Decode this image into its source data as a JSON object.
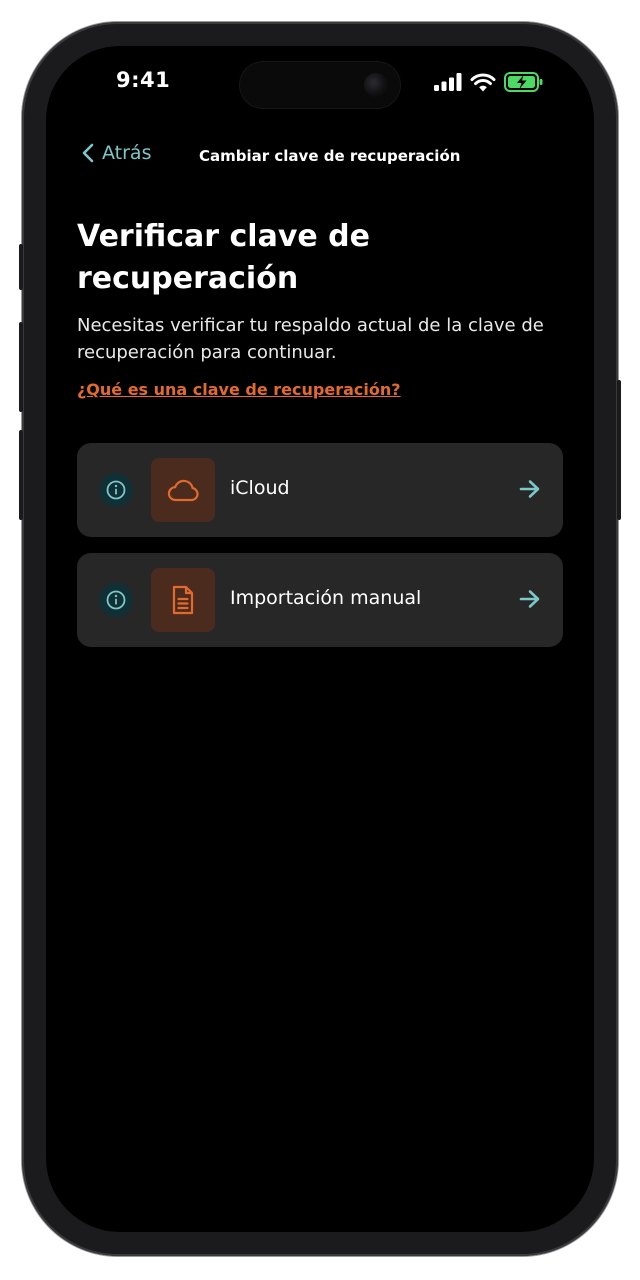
{
  "status_bar": {
    "time": "9:41"
  },
  "nav": {
    "back_label": "Atrás",
    "title": "Cambiar clave de recuperación"
  },
  "main": {
    "heading": "Verificar clave de recuperación",
    "description": "Necesitas verificar tu respaldo actual de la clave de recuperación para continuar.",
    "help_link": "¿Qué es una clave de recuperación?",
    "options": [
      {
        "label": "iCloud",
        "icon": "cloud-icon"
      },
      {
        "label": "Importación manual",
        "icon": "document-icon"
      }
    ]
  },
  "colors": {
    "accent_teal": "#7cc7c8",
    "accent_orange": "#e36a2e",
    "card_background": "#272727",
    "screen_background": "#000000"
  }
}
